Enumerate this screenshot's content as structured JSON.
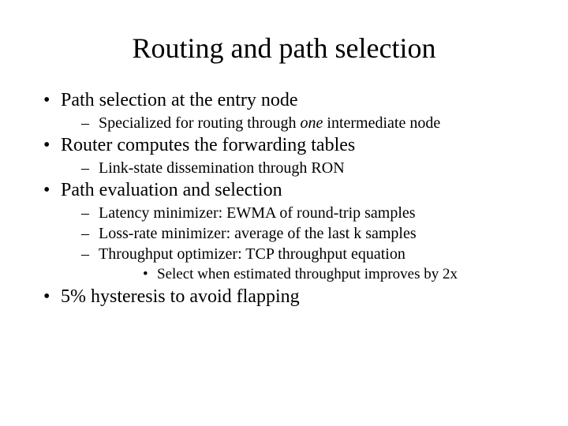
{
  "title": "Routing and path selection",
  "bullets": {
    "b1": "Path selection at the entry node",
    "b1_1_a": "Specialized for routing through ",
    "b1_1_em": "one",
    "b1_1_b": " intermediate node",
    "b2": "Router computes the forwarding tables",
    "b2_1": "Link-state dissemination through RON",
    "b3": "Path evaluation and selection",
    "b3_1": "Latency minimizer: EWMA of round-trip samples",
    "b3_2": "Loss-rate minimizer: average of the last k samples",
    "b3_3": "Throughput optimizer: TCP throughput equation",
    "b3_3_1": "Select when estimated throughput improves by 2x",
    "b4": "5% hysteresis to avoid flapping"
  }
}
